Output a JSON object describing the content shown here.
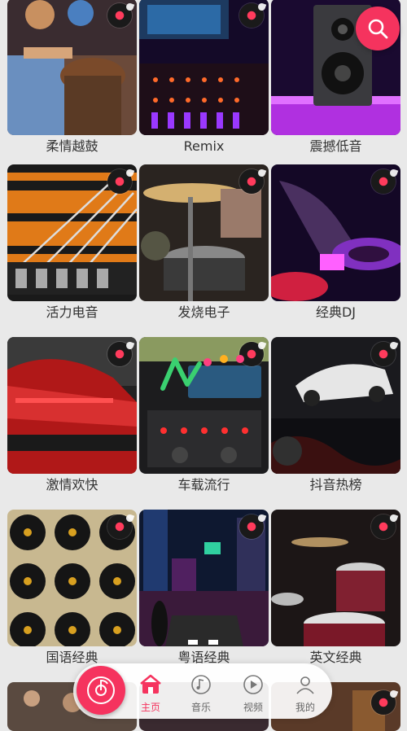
{
  "categories": [
    {
      "label": "柔情越鼓"
    },
    {
      "label": "Remix"
    },
    {
      "label": "震撼低音"
    },
    {
      "label": "活力电音"
    },
    {
      "label": "发烧电子"
    },
    {
      "label": "经典DJ"
    },
    {
      "label": "激情欢快"
    },
    {
      "label": "车载流行"
    },
    {
      "label": "抖音热榜"
    },
    {
      "label": "国语经典"
    },
    {
      "label": "粤语经典"
    },
    {
      "label": "英文经典"
    }
  ],
  "search": {
    "icon": "search-icon"
  },
  "nav": {
    "items": [
      {
        "label": "主页",
        "icon": "home-icon",
        "active": true
      },
      {
        "label": "音乐",
        "icon": "music-note-icon",
        "active": false
      },
      {
        "label": "视频",
        "icon": "play-icon",
        "active": false
      },
      {
        "label": "我的",
        "icon": "user-icon",
        "active": false
      }
    ]
  },
  "colors": {
    "accent": "#f5335e",
    "background": "#e9e9e9",
    "label": "#333333"
  }
}
